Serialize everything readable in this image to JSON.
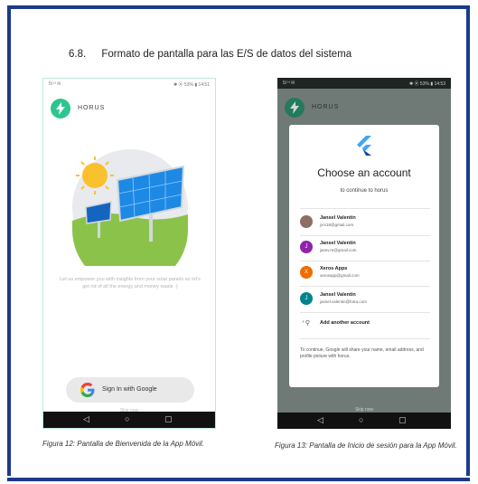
{
  "heading": {
    "number": "6.8.",
    "title": "Formato de pantalla para las E/S de datos del sistema"
  },
  "phone1": {
    "status_left": "5/ ᴴ ✉",
    "status_right": "✱ ⦿ 53% ▮ 14:51",
    "app_name": "HORUS",
    "tagline": "Let us empower you with insights from your solar panels an let's get rid of all the energy and money waste :)",
    "google_button": "Sign In with Google",
    "skip": "Skip now"
  },
  "phone2": {
    "status_left": "5/ ᴴ ✉",
    "status_right": "✱ ⦿ 53% ▮ 14:53",
    "app_name": "HORUS",
    "dialog_title": "Choose an account",
    "dialog_subtitle": "to continue to horus",
    "accounts": [
      {
        "name": "Jansel Valentin",
        "email": "jvrs16@gmail.com",
        "color": "#8d6e63",
        "initial": ""
      },
      {
        "name": "Jansel Valentin",
        "email": "jansv.re@gmail.com",
        "color": "#8e24aa",
        "initial": "J"
      },
      {
        "name": "Xeros Apps",
        "email": "xerosapp@gmail.com",
        "color": "#ef6c00",
        "initial": "X"
      },
      {
        "name": "Jansel Valentin",
        "email": "jansel.valentin@fotra.com",
        "color": "#00838f",
        "initial": "J"
      }
    ],
    "add_account": "Add another account",
    "footer": "To continue, Google will share your name, email address, and profile picture with horus.",
    "skip": "Skip now"
  },
  "captions": {
    "fig12": "Figura 12: Pantalla de Bienvenida de la App Móvil.",
    "fig13": "Figura 13: Pantalla de Inicio de sesión para la App Móvil."
  },
  "colors": {
    "frame": "#1b3a8a",
    "brand": "#2fc58f",
    "flutter": "#42a5f5"
  },
  "icons": [
    "bolt-icon",
    "google-g-icon",
    "flutter-logo-icon",
    "add-person-icon",
    "back-icon",
    "home-icon",
    "recents-icon"
  ]
}
